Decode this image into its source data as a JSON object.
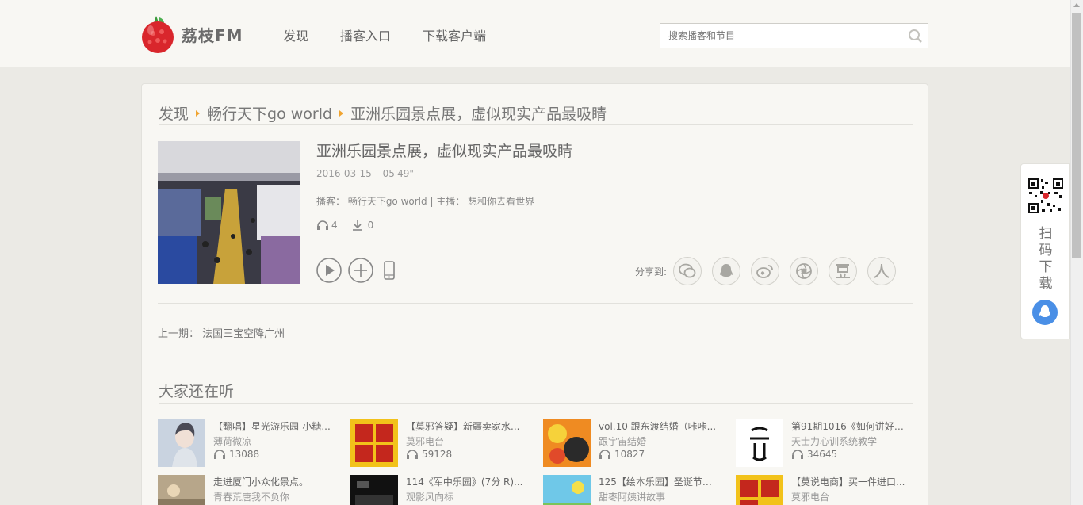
{
  "header": {
    "logo_text": "荔枝FM",
    "nav": [
      "发现",
      "播客入口",
      "下载客户端"
    ],
    "search_placeholder": "搜索播客和节目"
  },
  "breadcrumb": [
    "发现",
    "畅行天下go world",
    "亚洲乐园景点展，虚似现实产品最吸睛"
  ],
  "program": {
    "title": "亚洲乐园景点展，虚似现实产品最吸睛",
    "date": "2016-03-15",
    "duration": "05'49\"",
    "info": "播客： 畅行天下go world | 主播： 想和你去看世界",
    "listens": "4",
    "downloads": "0",
    "share_label": "分享到:"
  },
  "prev_episode": "上一期： 法国三宝空降广州",
  "also_listening": {
    "title": "大家还在听",
    "items": [
      {
        "title": "【翻唱】星光游乐园-小糖...",
        "author": "薄荷微凉",
        "count": "13088"
      },
      {
        "title": "【莫邪答疑】新疆卖家水...",
        "author": "莫邪电台",
        "count": "59128"
      },
      {
        "title": "vol.10 跟东渡结婚（咔咔...",
        "author": "跟宇宙结婚",
        "count": "10827"
      },
      {
        "title": "第91期1016《如何讲好核...",
        "author": "天士力心训系统教学",
        "count": "34645"
      },
      {
        "title": "走进厦门小众化景点。",
        "author": "青春荒唐我不负你",
        "count": ""
      },
      {
        "title": "114《军中乐园》(7分 R)...",
        "author": "观影风向标",
        "count": ""
      },
      {
        "title": "125【绘本乐园】圣诞节的...",
        "author": "甜枣阿姨讲故事",
        "count": ""
      },
      {
        "title": "【莫说电商】买一件进口...",
        "author": "莫邪电台",
        "count": ""
      }
    ]
  },
  "qr_panel": {
    "text": "扫码下载"
  },
  "colors": {
    "accent": "#f0a430",
    "background": "#ebeae5",
    "qq_blue": "#4a8fe6"
  }
}
